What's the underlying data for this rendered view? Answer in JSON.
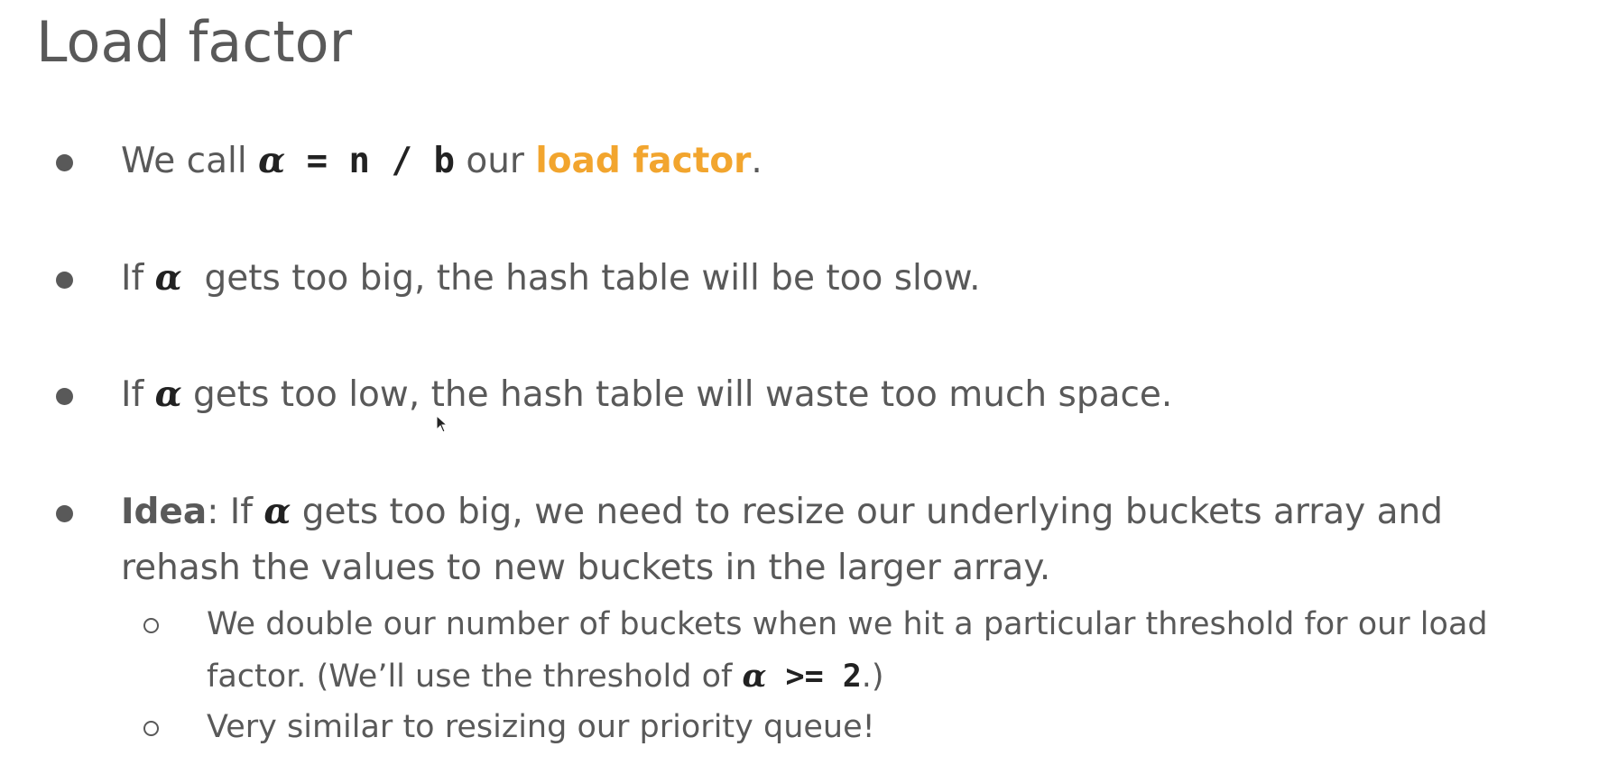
{
  "slide": {
    "title": "Load factor"
  },
  "bullets": {
    "b1": {
      "pre": "We call ",
      "alpha": "α",
      "code": " = n / b",
      "mid": " our ",
      "highlight": "load factor",
      "post": "."
    },
    "b2": {
      "pre": "If ",
      "alpha": "α",
      "post": "  gets too big, the hash table will be too slow."
    },
    "b3": {
      "pre": "If ",
      "alpha": "α",
      "post": " gets too low, the hash table will waste too much space."
    },
    "b4": {
      "bold": "Idea",
      "pre": ": If ",
      "alpha": "α",
      "line1_post": " gets too big, we need to resize our underlying buckets array and",
      "line2": "rehash the values to new buckets in the larger array."
    },
    "sub1": {
      "line1": "We double our number of buckets when we hit a particular threshold for our load",
      "line2_pre": "factor. (We’ll use the threshold of ",
      "alpha": "α",
      "code": " >= 2",
      "line2_post": ".)"
    },
    "sub2": {
      "text": "Very similar to resizing our priority queue!"
    }
  },
  "colors": {
    "text": "#595959",
    "highlight": "#f2a52e",
    "math": "#222222"
  }
}
